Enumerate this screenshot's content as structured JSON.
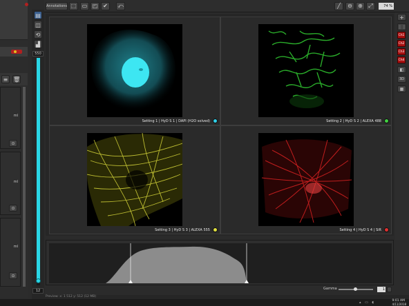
{
  "toolbar": {
    "annotations_label": "Annotations",
    "zoom_value": "74 %"
  },
  "left_panel": {
    "scale_top": "550",
    "scale_bottom": "12",
    "unit_label": "ml"
  },
  "tiles": [
    {
      "caption": "Setting 1 | HyD S 1 | DAPI (H2O solved)",
      "dot_color": "#30d0e8"
    },
    {
      "caption": "Setting 2 | HyD S 2 | ALEXA 488",
      "dot_color": "#40d040"
    },
    {
      "caption": "Setting 3 | HyD S 3 | ALEXA 555",
      "dot_color": "#e0e040"
    },
    {
      "caption": "Setting 4 | HyD S 4 | SiR",
      "dot_color": "#e03030"
    }
  ],
  "channels": [
    "Ch1",
    "Ch2",
    "Ch3",
    "Ch4"
  ],
  "right_buttons": {
    "three_d": "3D"
  },
  "histogram": {
    "gamma_label": "Gamma",
    "gamma_value": "1"
  },
  "status": {
    "text": "Preview: x: 1 512 y: 512 (12 MB)"
  },
  "taskbar": {
    "time": "9:01 AM",
    "date": "4/11/2018"
  },
  "colors": {
    "cyan": "#30d0e8",
    "green": "#40d040",
    "yellow": "#e0e040",
    "red": "#e03030"
  }
}
